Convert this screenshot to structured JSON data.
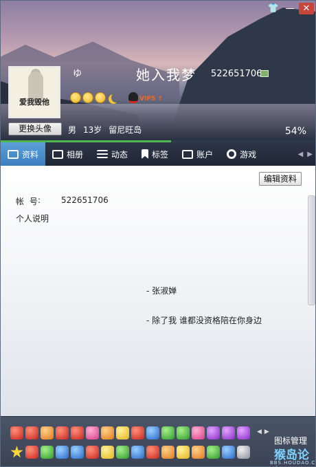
{
  "header": {
    "nickname": "她入我梦",
    "nick_mark": "ゆ",
    "qq_number": "522651706",
    "avatar_caption": "爱我毁他",
    "change_avatar": "更换头像",
    "gender": "男",
    "age": "13岁",
    "location": "留尼旺岛",
    "completeness_percent": "54%",
    "completeness_value": 54,
    "vip_label": "VIP5 ↑",
    "window_buttons": {
      "skin": "👕",
      "minimize": "—",
      "close": "✕"
    }
  },
  "tabs": [
    {
      "label": "资料",
      "icon": "profile-card-icon",
      "active": true
    },
    {
      "label": "相册",
      "icon": "photo-album-icon",
      "active": false
    },
    {
      "label": "动态",
      "icon": "feed-list-icon",
      "active": false
    },
    {
      "label": "标签",
      "icon": "bookmark-icon",
      "active": false
    },
    {
      "label": "账户",
      "icon": "wallet-icon",
      "active": false
    },
    {
      "label": "游戏",
      "icon": "gear-icon",
      "active": false
    }
  ],
  "tab_scroll": {
    "left": "◀",
    "right": "▶"
  },
  "content": {
    "edit_button": "编辑资料",
    "account_label": "帐 号",
    "account_colon": ":",
    "account_value": "522651706",
    "description_label": "个人说明",
    "signature_line1": "- 张淑婵",
    "signature_line2": "- 除了我  谁都没资格陪在你身边"
  },
  "iconbar": {
    "manage_label": "图标管理",
    "arrows": {
      "left": "◀",
      "right": "▶"
    },
    "watermark": "猴岛论坛",
    "watermark_sub": "BBS.HOUDAO.COM",
    "row1": [
      "red",
      "red",
      "orange",
      "red",
      "red",
      "pink",
      "orange",
      "yellow",
      "red",
      "blue",
      "green",
      "green",
      "pink",
      "purple",
      "purple",
      "purple"
    ],
    "row2": [
      "star",
      "red",
      "green",
      "blue",
      "blue",
      "red",
      "yellow",
      "green",
      "blue",
      "red",
      "orange",
      "yellow",
      "orange",
      "green",
      "blue",
      "gray"
    ]
  }
}
